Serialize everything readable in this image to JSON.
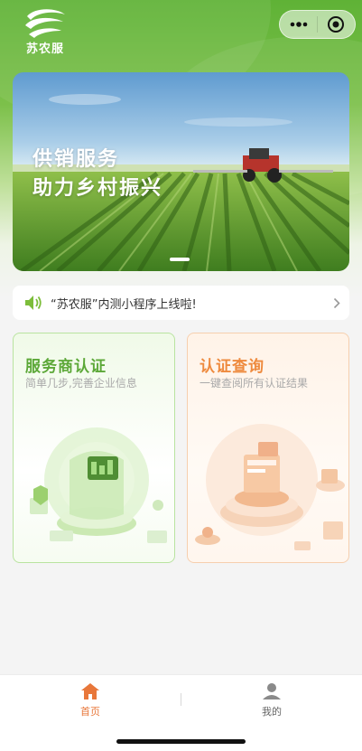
{
  "app": {
    "logo_text": "苏农服"
  },
  "capsule": {
    "more_icon": "more-dots-icon",
    "close_icon": "target-close-icon"
  },
  "banner": {
    "line1": "供销服务",
    "line2": "助力乡村振兴",
    "active_index": 1
  },
  "notice": {
    "text": "“苏农服”内测小程序上线啦!",
    "icon": "speaker-icon"
  },
  "cards": [
    {
      "title": "服务商认证",
      "subtitle": "简单几步,完善企业信息",
      "accent": "#5ca838"
    },
    {
      "title": "认证查询",
      "subtitle": "一键查阅所有认证结果",
      "accent": "#ee8a3e"
    }
  ],
  "tabbar": {
    "tabs": [
      {
        "label": "首页",
        "icon": "home-icon",
        "active": true,
        "color": "#e8773a"
      },
      {
        "label": "我的",
        "icon": "user-icon",
        "active": false,
        "color": "#666666"
      }
    ]
  },
  "colors": {
    "brand_green": "#5fb236",
    "accent_orange": "#e8773a"
  }
}
